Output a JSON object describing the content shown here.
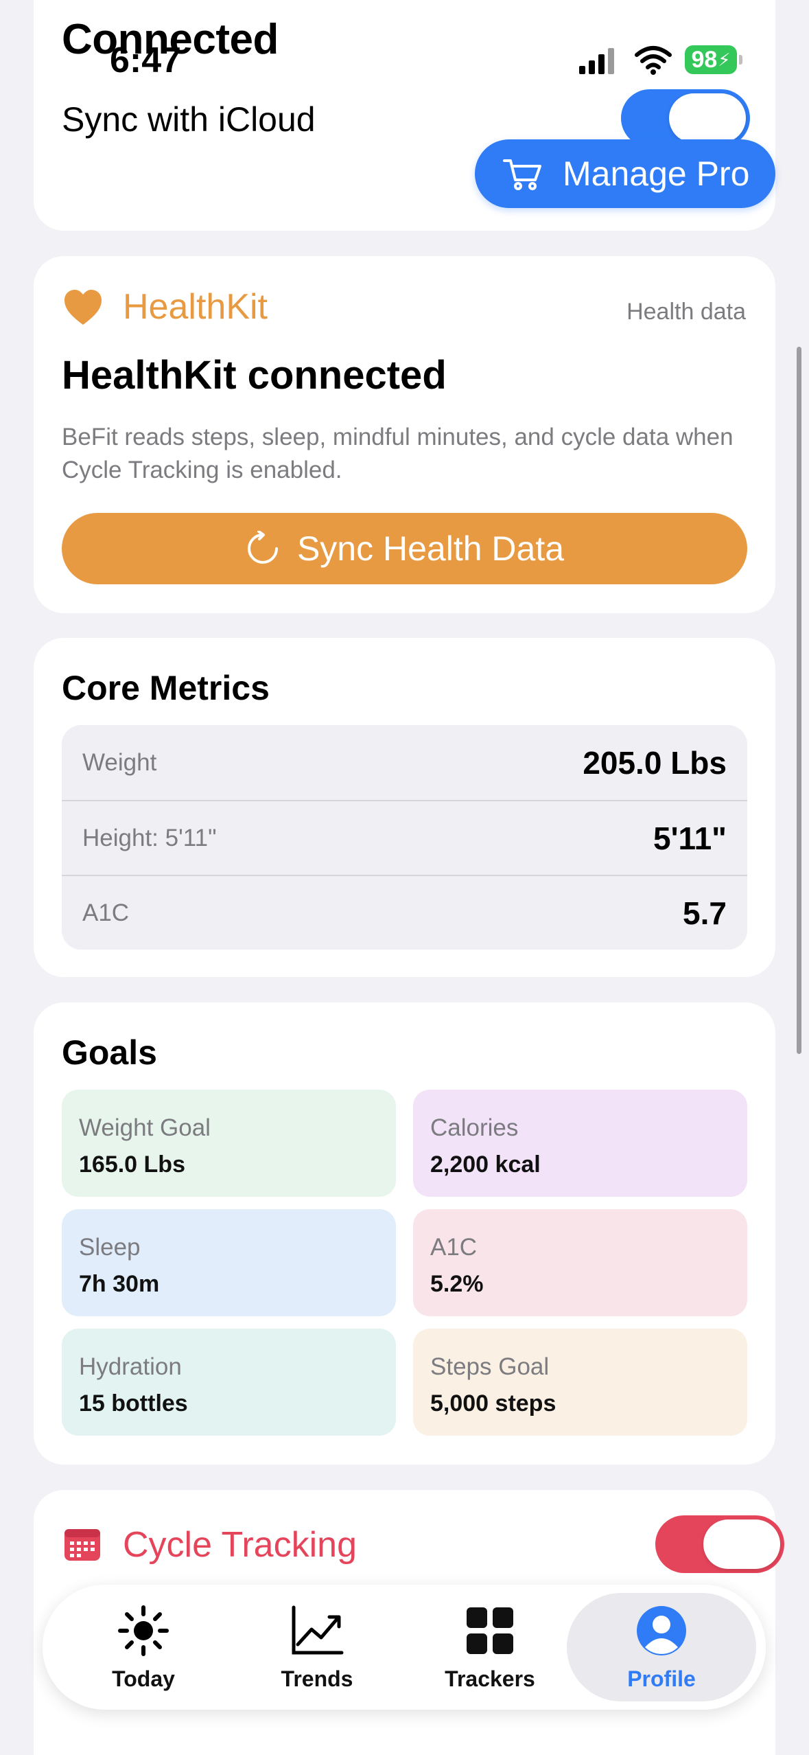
{
  "status_bar": {
    "time": "6:47",
    "battery": "98"
  },
  "icloud_card": {
    "title": "Connected",
    "sync_label": "Sync with iCloud",
    "sync_enabled": true,
    "manage_pro_label": "Manage Pro"
  },
  "healthkit": {
    "title": "HealthKit",
    "tag": "Health data",
    "headline": "HealthKit connected",
    "description": "BeFit reads steps, sleep, mindful minutes, and cycle data when Cycle Tracking is enabled.",
    "sync_button": "Sync Health Data",
    "colors": {
      "accent": "#E89A42"
    }
  },
  "core_metrics": {
    "title": "Core Metrics",
    "rows": [
      {
        "label": "Weight",
        "value": "205.0 Lbs"
      },
      {
        "label": "Height: 5'11\"",
        "value": "5'11\""
      },
      {
        "label": "A1C",
        "value": "5.7"
      }
    ]
  },
  "goals": {
    "title": "Goals",
    "tiles": [
      {
        "label": "Weight Goal",
        "value": "165.0 Lbs",
        "color": "#E8F5EC"
      },
      {
        "label": "Calories",
        "value": "2,200 kcal",
        "color": "#F2E3F8"
      },
      {
        "label": "Sleep",
        "value": "7h 30m",
        "color": "#E1EDFB"
      },
      {
        "label": "A1C",
        "value": "5.2%",
        "color": "#F9E4EA"
      },
      {
        "label": "Hydration",
        "value": "15 bottles",
        "color": "#E2F3F1"
      },
      {
        "label": "Steps Goal",
        "value": "5,000 steps",
        "color": "#FAF0E4"
      }
    ]
  },
  "cycle_tracking": {
    "title": "Cycle Tracking",
    "enabled": true,
    "accent": "#E5455B"
  },
  "tabbar": {
    "tabs": [
      {
        "label": "Today",
        "icon": "sun-icon"
      },
      {
        "label": "Trends",
        "icon": "chart-line-icon"
      },
      {
        "label": "Trackers",
        "icon": "grid-icon"
      },
      {
        "label": "Profile",
        "icon": "person-circle-icon",
        "active": true
      }
    ]
  },
  "colors": {
    "primary": "#2F7CF6",
    "background": "#F2F1F6"
  }
}
